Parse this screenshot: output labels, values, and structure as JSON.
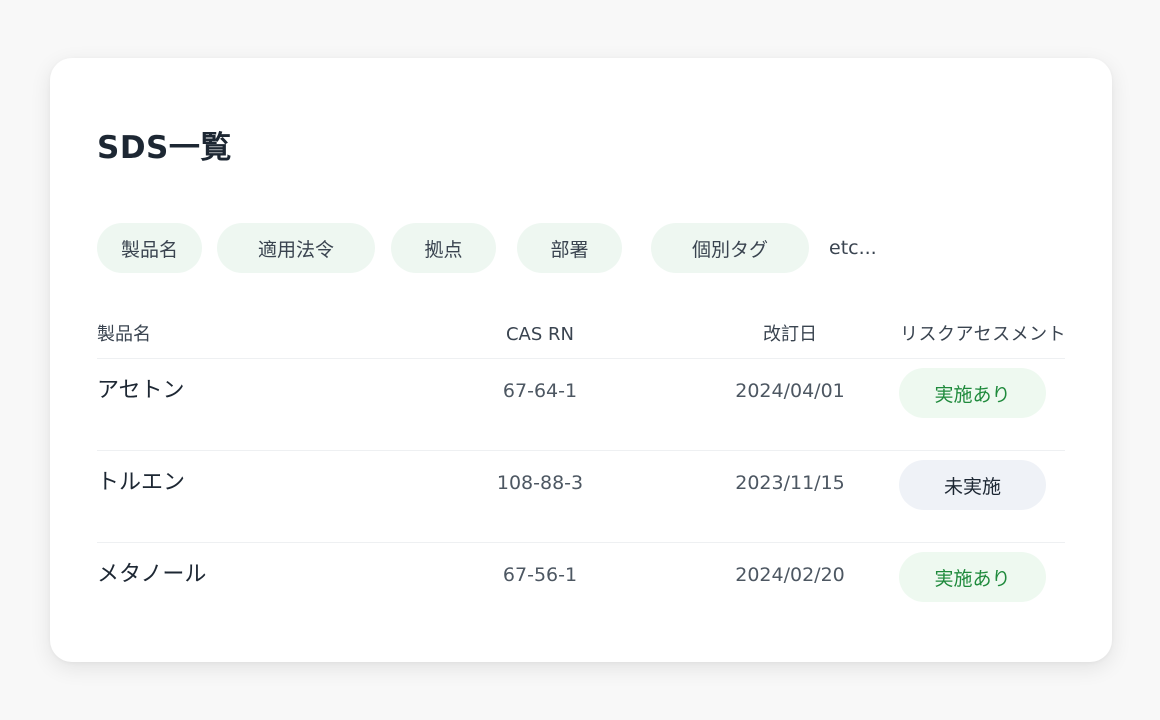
{
  "title": "SDS一覧",
  "filters": {
    "chips": [
      "製品名",
      "適用法令",
      "拠点",
      "部署",
      "個別タグ"
    ],
    "more": "etc..."
  },
  "table": {
    "headers": {
      "name": "製品名",
      "cas": "CAS RN",
      "revised": "改訂日",
      "risk": "リスクアセスメント"
    },
    "rows": [
      {
        "name": "アセトン",
        "cas": "67-64-1",
        "revised": "2024/04/01",
        "risk": "実施あり",
        "status": "done"
      },
      {
        "name": "トルエン",
        "cas": "108-88-3",
        "revised": "2023/11/15",
        "risk": "未実施",
        "status": "pending"
      },
      {
        "name": "メタノール",
        "cas": "67-56-1",
        "revised": "2024/02/20",
        "risk": "実施あり",
        "status": "done"
      }
    ]
  },
  "colors": {
    "chip_bg": "#eef7f1",
    "done_bg": "#eef9f0",
    "done_text": "#1f8a3c",
    "pending_bg": "#eff2f7",
    "text_dark": "#1d2733"
  }
}
